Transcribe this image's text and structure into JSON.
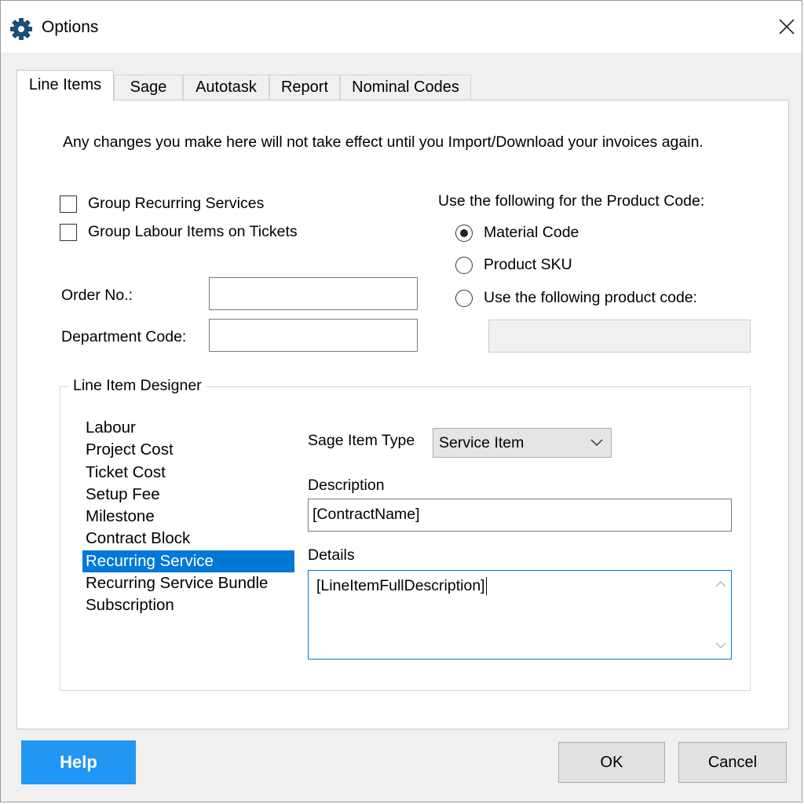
{
  "window": {
    "title": "Options",
    "title_icon": "gear-icon",
    "close_icon": "close-icon"
  },
  "tabs": [
    {
      "label": "Line Items",
      "active": true
    },
    {
      "label": "Sage",
      "active": false
    },
    {
      "label": "Autotask",
      "active": false
    },
    {
      "label": "Report",
      "active": false
    },
    {
      "label": "Nominal Codes",
      "active": false
    }
  ],
  "line_items": {
    "notice": "Any changes you make here will not take effect until you Import/Download your invoices again.",
    "checkboxes": [
      {
        "label": "Group Recurring Services",
        "checked": false
      },
      {
        "label": "Group Labour Items on Tickets",
        "checked": false
      }
    ],
    "order_no": {
      "label": "Order No.:",
      "value": ""
    },
    "department_code": {
      "label": "Department Code:",
      "value": ""
    },
    "product_code": {
      "heading": "Use the following for the Product Code:",
      "options": [
        {
          "label": "Material Code",
          "checked": true
        },
        {
          "label": "Product SKU",
          "checked": false
        },
        {
          "label": "Use the following product code:",
          "checked": false
        }
      ],
      "custom_value": ""
    },
    "designer": {
      "title": "Line Item Designer",
      "items": [
        "Labour",
        "Project Cost",
        "Ticket Cost",
        "Setup Fee",
        "Milestone",
        "Contract Block",
        "Recurring Service",
        "Recurring Service Bundle",
        "Subscription"
      ],
      "selected_item": "Recurring Service",
      "sage_item_type": {
        "label": "Sage Item Type",
        "value": "Service Item"
      },
      "description": {
        "label": "Description",
        "value": "[ContractName]"
      },
      "details": {
        "label": "Details",
        "value": "[LineItemFullDescription]"
      }
    }
  },
  "buttons": {
    "help": "Help",
    "ok": "OK",
    "cancel": "Cancel"
  },
  "colors": {
    "accent": "#0078d7",
    "help_button": "#2196f3",
    "gear_icon": "#1b4e78"
  }
}
